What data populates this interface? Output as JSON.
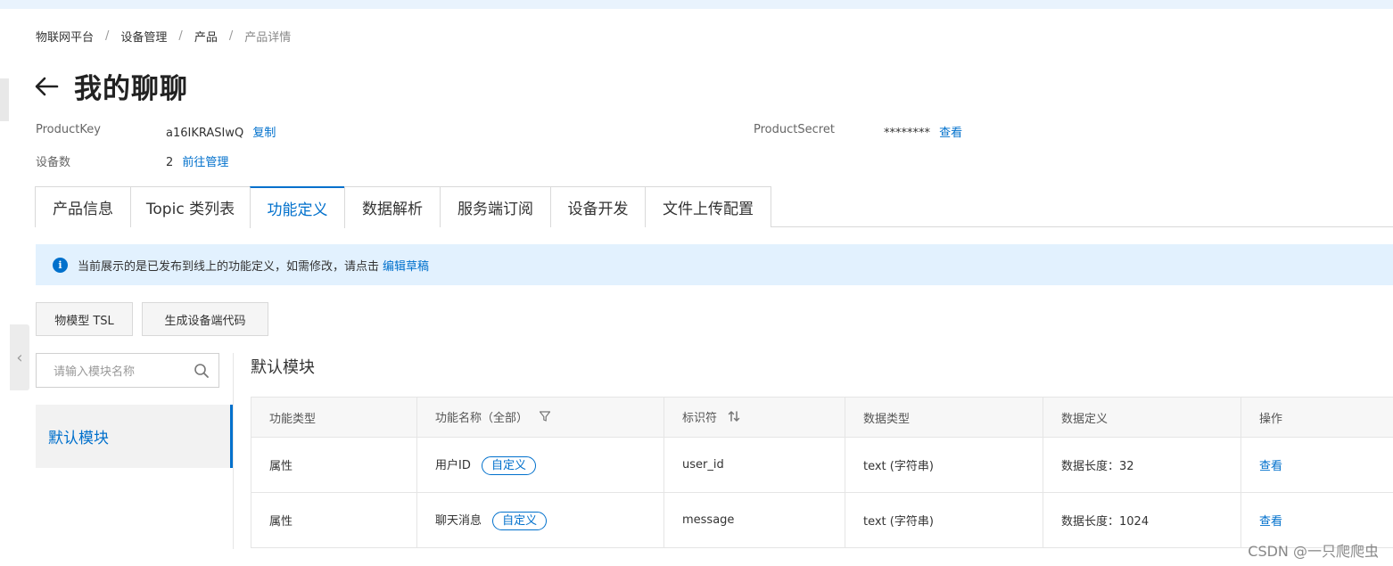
{
  "breadcrumb": {
    "items": [
      "物联网平台",
      "设备管理",
      "产品",
      "产品详情"
    ]
  },
  "page": {
    "title": "我的聊聊"
  },
  "product": {
    "key_label": "ProductKey",
    "key_value": "a16IKRASIwQ",
    "copy_label": "复制",
    "secret_label": "ProductSecret",
    "secret_value": "********",
    "view_label": "查看",
    "device_count_label": "设备数",
    "device_count_value": "2",
    "manage_label": "前往管理"
  },
  "tabs": [
    {
      "label": "产品信息"
    },
    {
      "label": "Topic 类列表"
    },
    {
      "label": "功能定义",
      "active": true
    },
    {
      "label": "数据解析"
    },
    {
      "label": "服务端订阅"
    },
    {
      "label": "设备开发"
    },
    {
      "label": "文件上传配置"
    }
  ],
  "notice": {
    "text": "当前展示的是已发布到线上的功能定义，如需修改，请点击",
    "link": "编辑草稿"
  },
  "buttons": {
    "tsl": "物模型 TSL",
    "gen_code": "生成设备端代码"
  },
  "search": {
    "placeholder": "请输入模块名称"
  },
  "modules": [
    {
      "label": "默认模块"
    }
  ],
  "module_title": "默认模块",
  "table": {
    "headers": [
      "功能类型",
      "功能名称（全部）",
      "标识符",
      "数据类型",
      "数据定义",
      "操作"
    ],
    "rows": [
      {
        "type": "属性",
        "name": "用户ID",
        "tag": "自定义",
        "identifier": "user_id",
        "data_type": "text (字符串)",
        "definition": "数据长度：32",
        "action": "查看"
      },
      {
        "type": "属性",
        "name": "聊天消息",
        "tag": "自定义",
        "identifier": "message",
        "data_type": "text (字符串)",
        "definition": "数据长度：1024",
        "action": "查看"
      }
    ]
  },
  "watermark": "CSDN @一只爬爬虫",
  "colors": {
    "accent": "#0070cc",
    "notice_bg": "#e2f1fe",
    "border": "#d9d9d9"
  }
}
